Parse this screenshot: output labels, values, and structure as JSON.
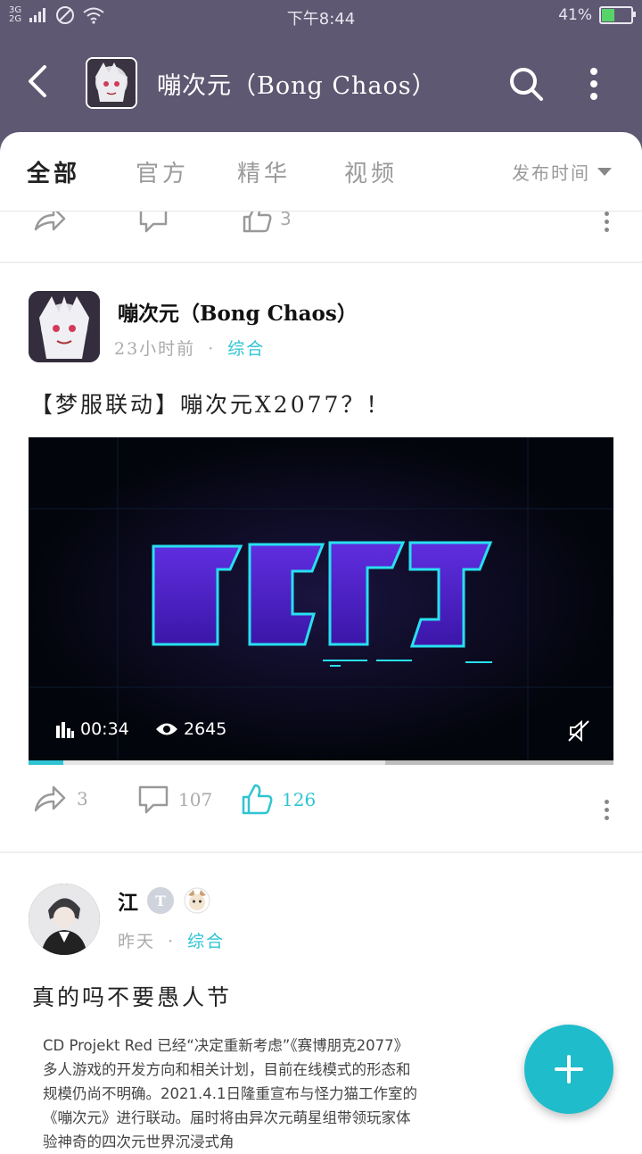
{
  "status_bar": {
    "network_top": "3G",
    "network_bottom": "2G",
    "time": "下午8:44",
    "battery": "41%",
    "battery_level": 0.41
  },
  "header": {
    "title": "嘣次元（Bong Chaos）"
  },
  "tabs": {
    "items": [
      {
        "label": "全部",
        "active": true
      },
      {
        "label": "官方",
        "active": false
      },
      {
        "label": "精华",
        "active": false
      },
      {
        "label": "视频",
        "active": false
      }
    ],
    "sort_label": "发布时间"
  },
  "prev_post": {
    "likes": "3"
  },
  "post1": {
    "author": "嘣次元（Bong Chaos）",
    "time": "23小时前",
    "dot": "·",
    "category": "综合",
    "title": "【梦服联动】嘣次元X2077？！",
    "video": {
      "duration": "00:34",
      "views": "2645",
      "progress": 0.06
    },
    "shares": "3",
    "comments": "107",
    "likes": "126"
  },
  "post2": {
    "author": "江",
    "badge": "T",
    "time": "昨天",
    "dot": "·",
    "category": "综合",
    "title": "真的吗不要愚人节",
    "quote": "CD Projekt Red 已经“决定重新考虑”《赛博朋克2077》多人游戏的开发方向和相关计划，目前在线模式的形态和规模仍尚不明确。2021.4.1日隆重宣布与怪力猫工作室的《嘣次元》进行联动。届时将由异次元萌星组带领玩家体验神奇的四次元世界沉浸式角"
  },
  "colors": {
    "header_bg": "#5e5872",
    "accent": "#2ec4d3",
    "fab": "#1fbccb"
  }
}
